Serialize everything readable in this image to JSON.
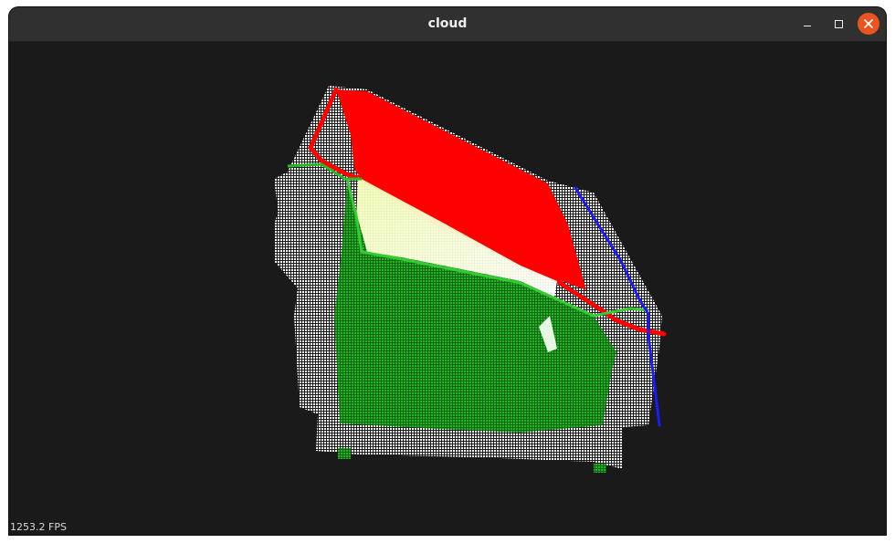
{
  "window": {
    "title": "cloud"
  },
  "icons": {
    "minimize": "minimize-icon",
    "maximize": "maximize-icon",
    "close": "close-icon"
  },
  "colors": {
    "close_accent": "#e95420",
    "background": "#1a1a1a",
    "cloud_white": "#ffffff",
    "cloud_red": "#ff0000",
    "cloud_green": "#22aa22",
    "cloud_blue": "#1a1aff"
  },
  "viewer": {
    "fps_text": "1253.2 FPS"
  }
}
